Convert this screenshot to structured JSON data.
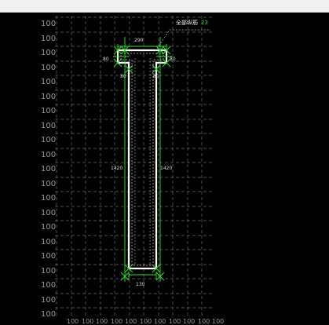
{
  "grid": {
    "label": "100"
  },
  "dimensions": {
    "top_width": "290",
    "flange_left": "80",
    "flange_right": "80",
    "web_top_left": "80",
    "web_top_right": "80",
    "height_left": "1420",
    "height_right": "1420",
    "bottom_width": "130"
  },
  "legend": {
    "text": "全部纵筋",
    "count": "23"
  },
  "colors": {
    "background": "#000000",
    "outline": "#ffffff",
    "grid": "#6a6a6a",
    "rebar": "#2fe22f"
  }
}
